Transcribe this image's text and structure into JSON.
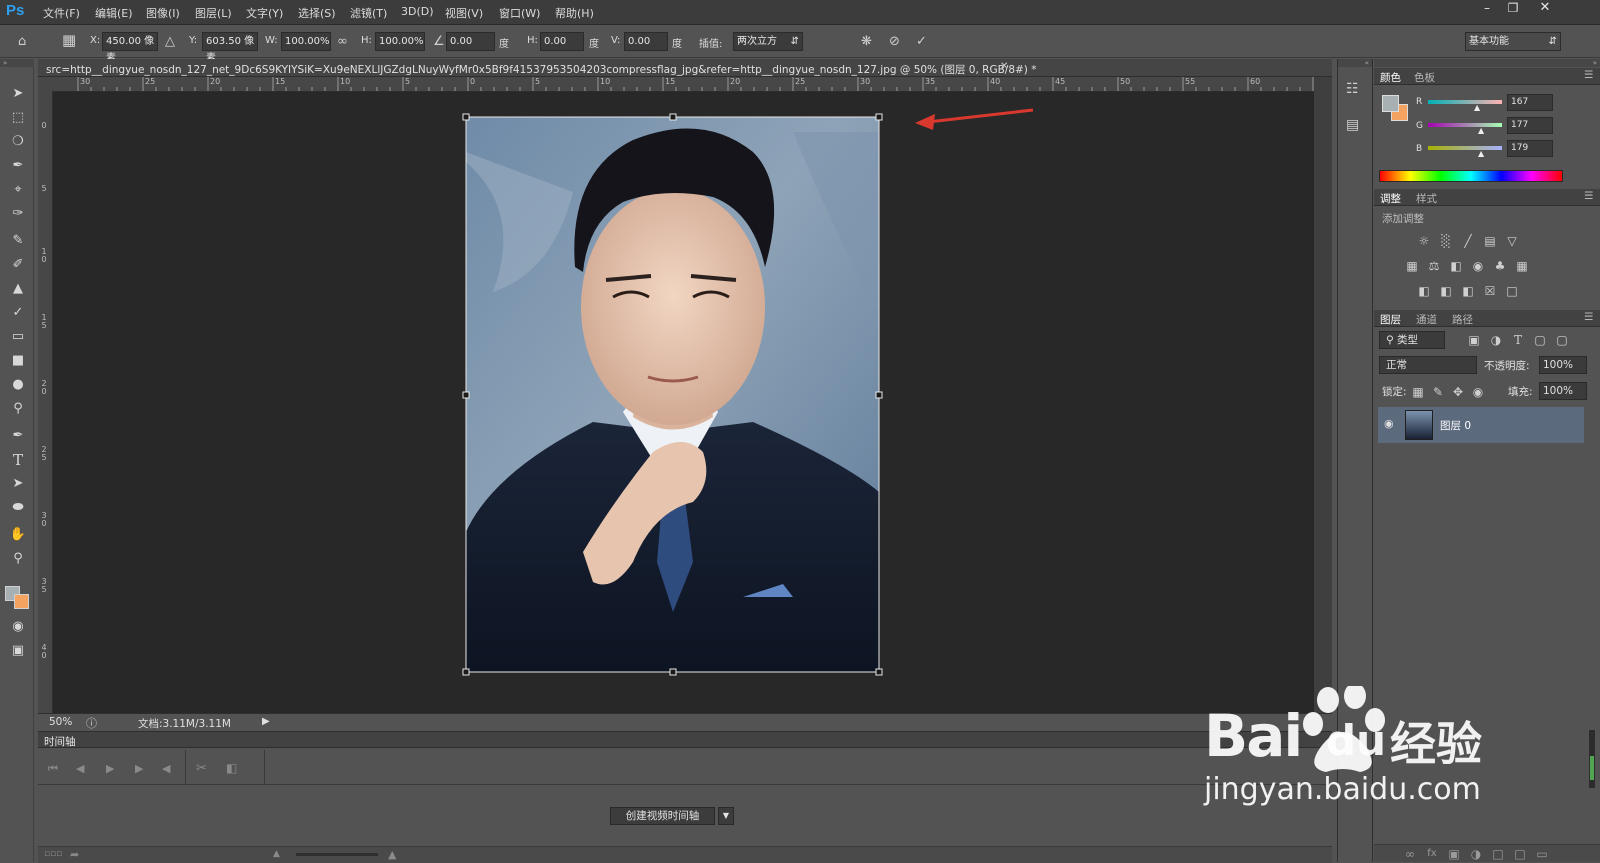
{
  "app": {
    "logo": "Ps"
  },
  "menubar": {
    "items": [
      "文件(F)",
      "编辑(E)",
      "图像(I)",
      "图层(L)",
      "文字(Y)",
      "选择(S)",
      "滤镜(T)",
      "3D(D)",
      "视图(V)",
      "窗口(W)",
      "帮助(H)"
    ],
    "window_controls": [
      "minimize-icon",
      "restore-icon",
      "close-icon"
    ]
  },
  "options_bar": {
    "x_label": "X:",
    "x_value": "450.00 像素",
    "y_label": "Y:",
    "y_value": "603.50 像素",
    "w_label": "W:",
    "w_value": "100.00%",
    "h_label": "H:",
    "h_value": "100.00%",
    "angle_value": "0.00",
    "angle_unit": "度",
    "hskew_label": "H:",
    "hskew_value": "0.00",
    "hskew_unit": "度",
    "vskew_label": "V:",
    "vskew_value": "0.00",
    "vskew_unit": "度",
    "interp_label": "插值:",
    "interp_value": "两次立方",
    "workspace": "基本功能"
  },
  "document": {
    "tab_title": "src=http__dingyue_nosdn_127_net_9Dc6S9KYIYSiK=Xu9eNEXLlJGZdgLNuyWyfMr0x5Bf9f41537953504203compressflag_jpg&refer=http__dingyue_nosdn_127.jpg  @  50%  (图层 0, RGB/8#) *",
    "zoom": "50%",
    "doc_size": "文档:3.11M/3.11M"
  },
  "rulers": {
    "h_ticks": [
      "30",
      "25",
      "20",
      "15",
      "10",
      "5",
      "0",
      "5",
      "10",
      "15",
      "20",
      "25",
      "30",
      "35",
      "40",
      "45",
      "50",
      "55",
      "60"
    ],
    "v_ticks": [
      "0",
      "5",
      "10",
      "15",
      "20",
      "25",
      "30",
      "35",
      "40"
    ]
  },
  "timeline": {
    "title": "时间轴",
    "create_button": "创建视频时间轴"
  },
  "color_panel": {
    "tabs": [
      "颜色",
      "色板"
    ],
    "r_label": "R",
    "r_value": "167",
    "g_label": "G",
    "g_value": "177",
    "b_label": "B",
    "b_value": "179",
    "foreground": "#a7b1b3",
    "background": "#f4a460"
  },
  "adjustments_panel": {
    "tabs": [
      "调整",
      "样式"
    ],
    "title": "添加调整"
  },
  "layers_panel": {
    "tabs": [
      "图层",
      "通道",
      "路径"
    ],
    "filter": "类型",
    "blend_mode": "正常",
    "opacity_label": "不透明度:",
    "opacity_value": "100%",
    "lock_label": "锁定:",
    "fill_label": "填充:",
    "fill_value": "100%",
    "layers": [
      {
        "name": "图层 0"
      }
    ]
  },
  "watermark": {
    "brand": "Bai",
    "brand2": "du",
    "cn": "经验",
    "url": "jingyan.baidu.com"
  },
  "colors": {
    "accent": "#d9382e",
    "ps_blue": "#2f9ff0"
  }
}
